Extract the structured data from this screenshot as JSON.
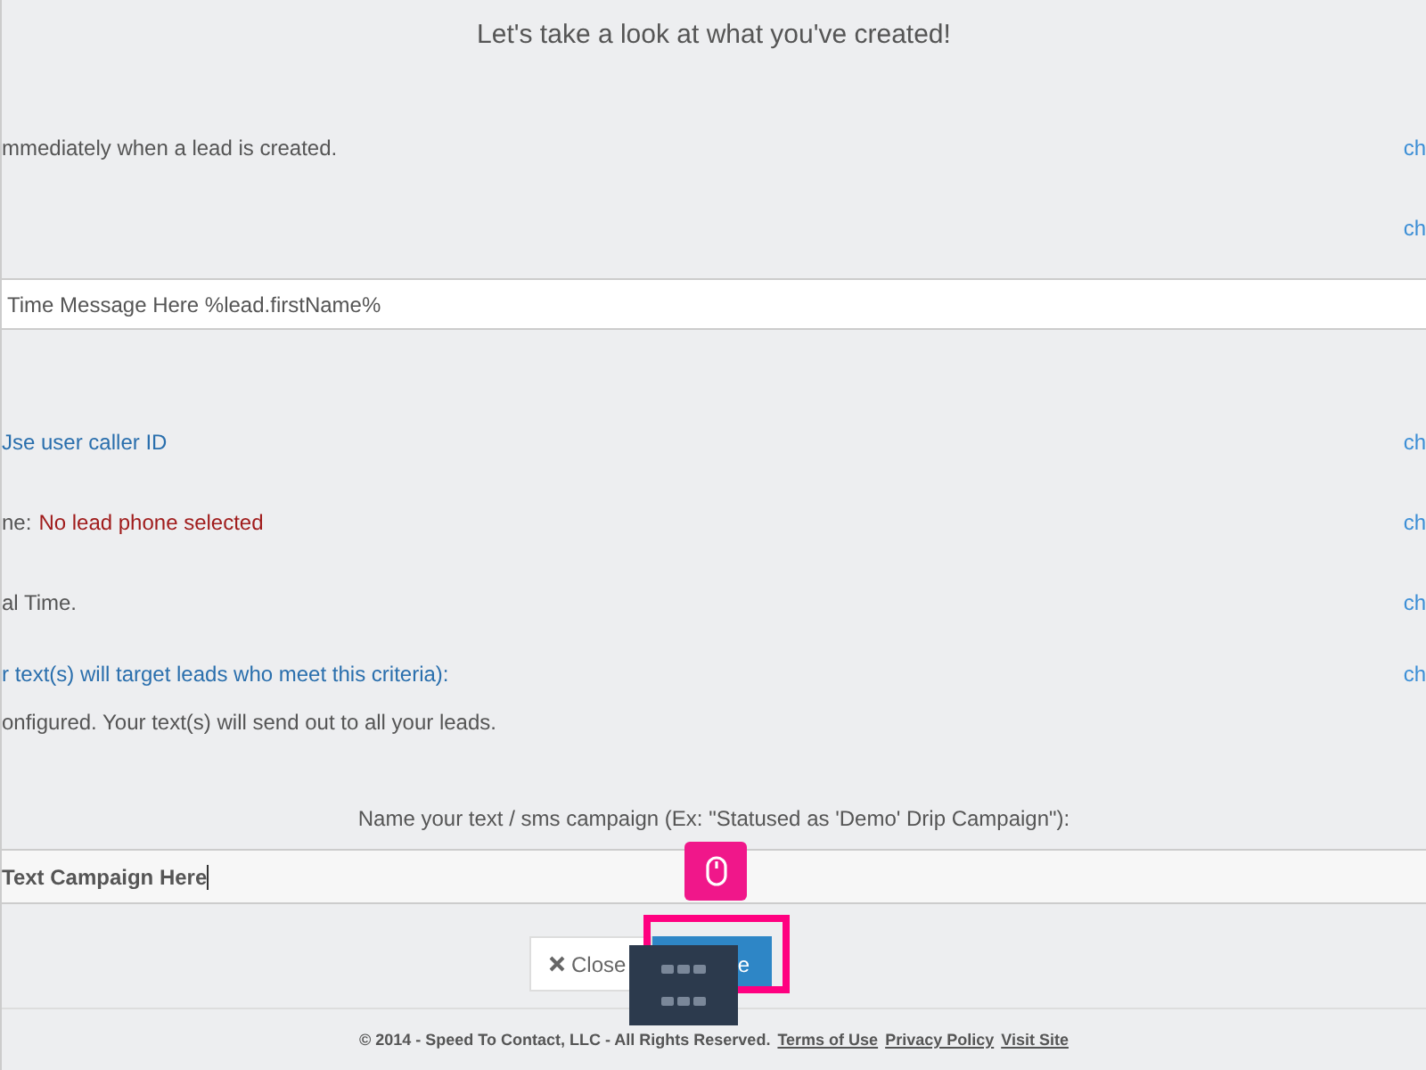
{
  "title": "Let's take a look at what you've created!",
  "rows": [
    {
      "kind": "text",
      "parts": [
        {
          "text": "mmediately when a lead is created.",
          "color": "#555555"
        }
      ],
      "link": "ch"
    },
    {
      "kind": "blank",
      "link": "ch"
    },
    {
      "kind": "field",
      "value": "Time Message Here %lead.firstName%"
    },
    {
      "kind": "text",
      "parts": [
        {
          "text": "Jse user caller ID",
          "color": "#2a6fad"
        }
      ],
      "link": "ch"
    },
    {
      "kind": "text",
      "parts": [
        {
          "text": "ne:",
          "color": "#555555"
        },
        {
          "text": "No lead phone selected",
          "color": "#a01c1c"
        }
      ],
      "link": "ch"
    },
    {
      "kind": "text",
      "parts": [
        {
          "text": "al Time.",
          "color": "#555555"
        }
      ],
      "link": "ch"
    },
    {
      "kind": "text",
      "parts": [
        {
          "text": "r text(s) will target leads who meet this criteria):",
          "color": "#2a6fad"
        }
      ],
      "link": "ch",
      "note": "onfigured. Your text(s) will send out to all your leads."
    }
  ],
  "name_label": "Name your text / sms campaign (Ex: \"Statused as 'Demo' Drip Campaign\"):",
  "name_value": "Text Campaign Here",
  "close_button": "Close",
  "save_button_visible": "e",
  "footer": {
    "text": "© 2014 - Speed To Contact, LLC - All Rights Reserved.",
    "links": [
      "Terms of Use",
      "Privacy Policy",
      "Visit Site"
    ]
  }
}
